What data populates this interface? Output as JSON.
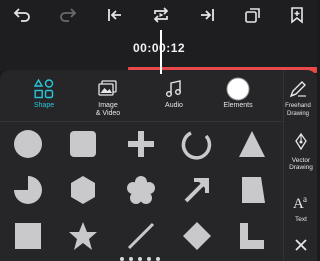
{
  "timeline": {
    "timecode": "00:00:12"
  },
  "tabs": [
    {
      "label": "Shape",
      "icon": "shapes-icon",
      "active": true
    },
    {
      "label": "Image\n& Video",
      "icon": "image-video-icon",
      "active": false
    },
    {
      "label": "Audio",
      "icon": "music-note-icon",
      "active": false
    },
    {
      "label": "Elements",
      "icon": "elements-icon",
      "active": false
    },
    {
      "label": "Freehand\nDrawing",
      "icon": "pen-icon",
      "active": false
    }
  ],
  "side_tools": [
    {
      "label": "Vector\nDrawing",
      "icon": "vector-pen-icon"
    },
    {
      "label": "Text",
      "icon": "text-icon"
    }
  ],
  "shapes": [
    "circle",
    "rounded-square",
    "plus",
    "arc",
    "triangle",
    "pie",
    "hexagon",
    "flower",
    "arrow",
    "trapezoid",
    "square",
    "star",
    "line",
    "diamond",
    "l-shape"
  ],
  "colors": {
    "accent": "#27c6d8",
    "track": "#e84a4a",
    "shape_fill": "#c9c9cc"
  }
}
